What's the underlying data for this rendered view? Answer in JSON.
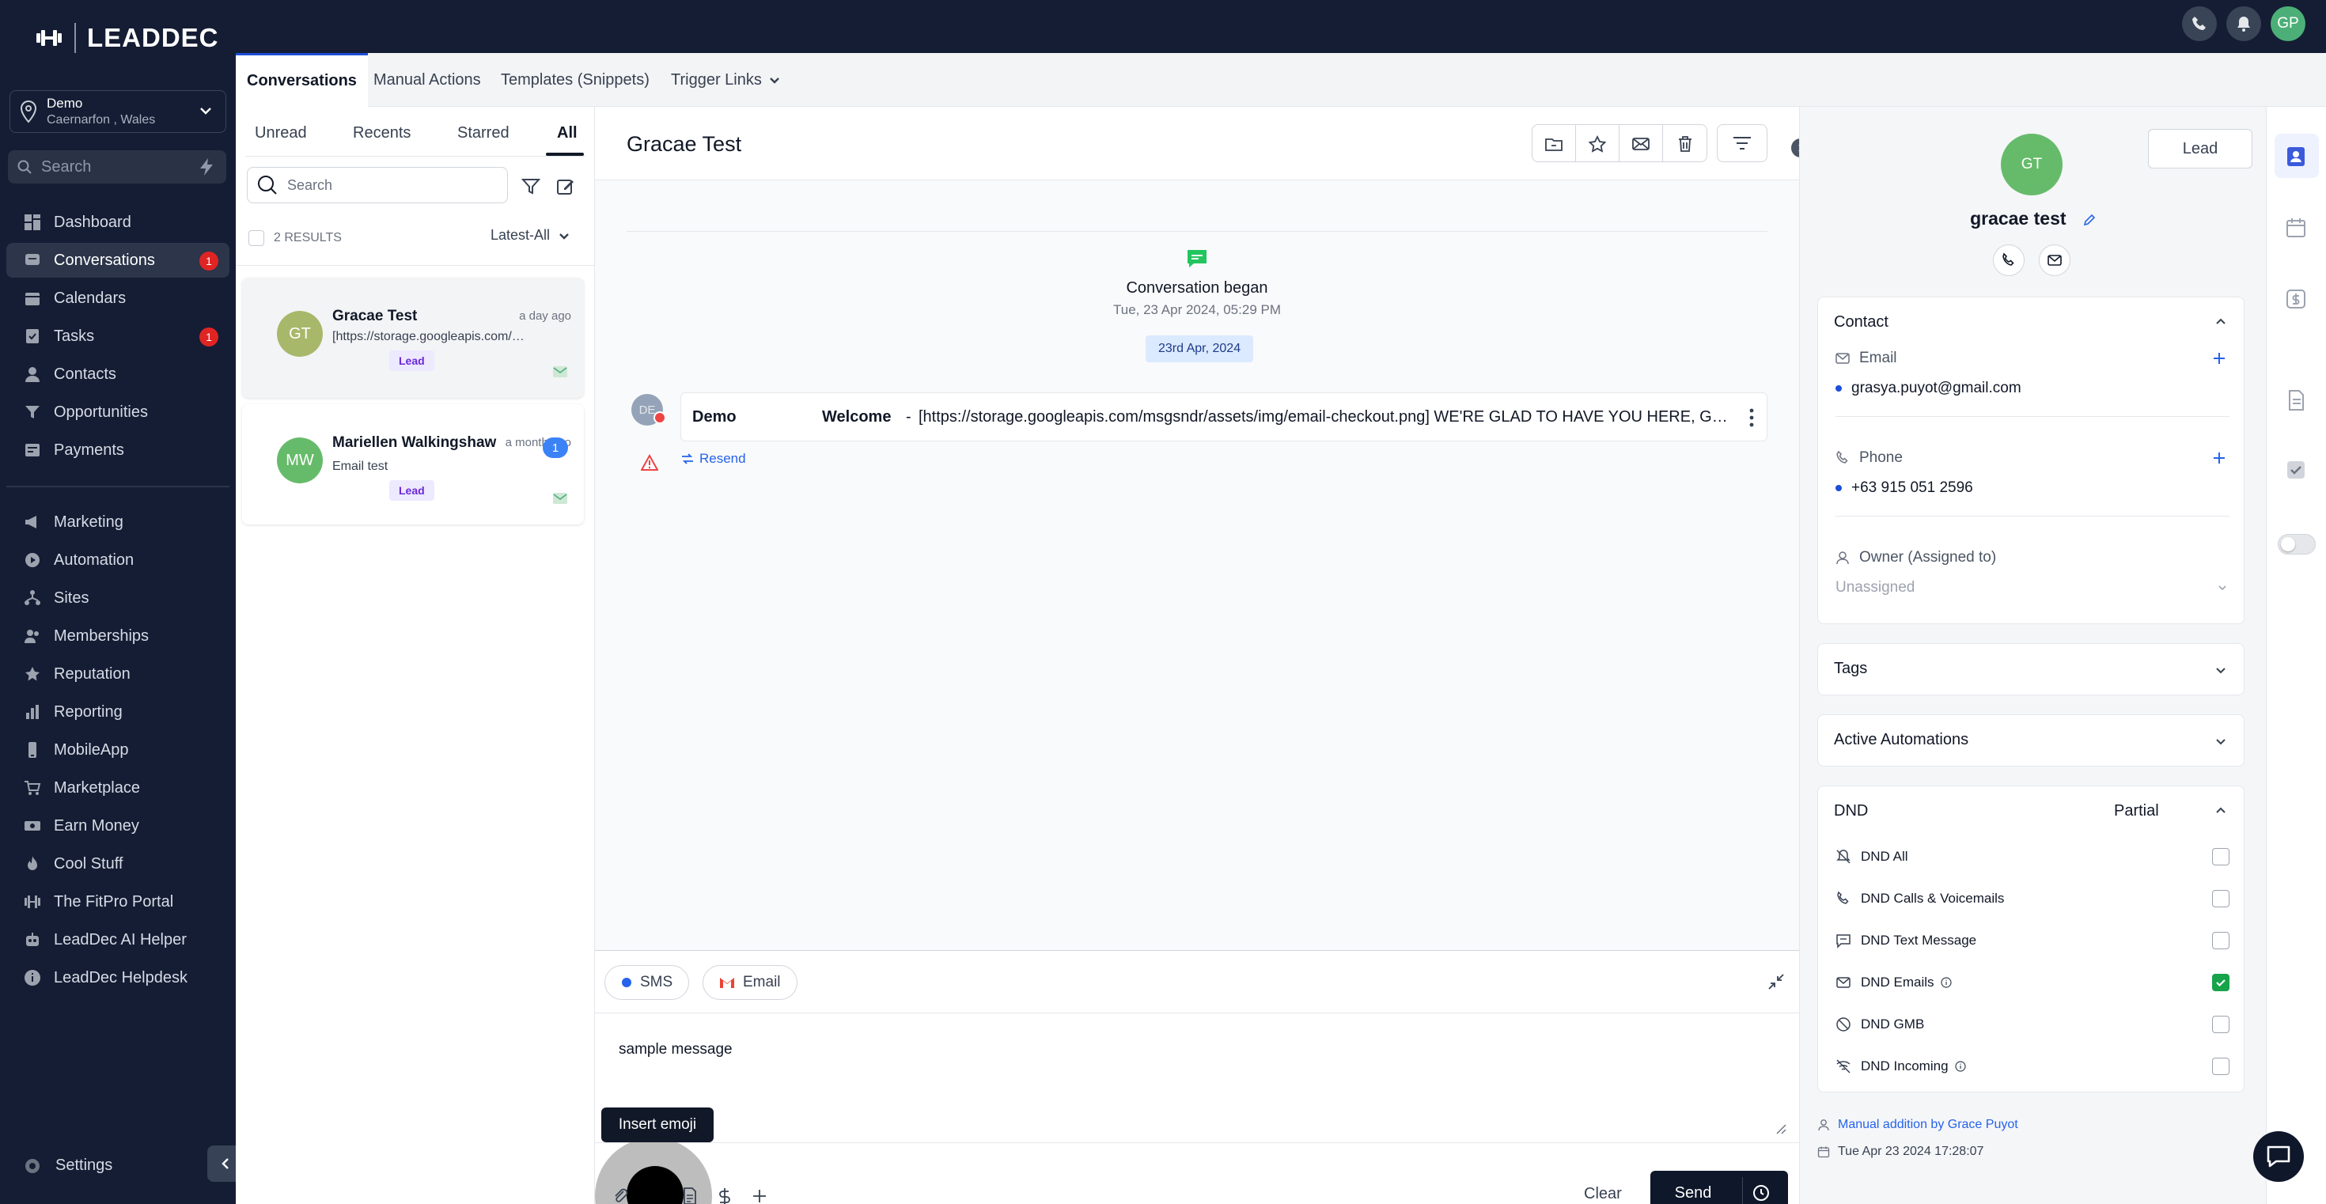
{
  "brand": {
    "name": "LEADDEC"
  },
  "location": {
    "name": "Demo",
    "sub": "Caernarfon , Wales"
  },
  "sidebar": {
    "search_placeholder": "Search",
    "items": [
      {
        "label": "Dashboard"
      },
      {
        "label": "Conversations",
        "badge": "1"
      },
      {
        "label": "Calendars"
      },
      {
        "label": "Tasks",
        "badge": "1"
      },
      {
        "label": "Contacts"
      },
      {
        "label": "Opportunities"
      },
      {
        "label": "Payments"
      }
    ],
    "items2": [
      {
        "label": "Marketing"
      },
      {
        "label": "Automation"
      },
      {
        "label": "Sites"
      },
      {
        "label": "Memberships"
      },
      {
        "label": "Reputation"
      },
      {
        "label": "Reporting"
      },
      {
        "label": "MobileApp"
      },
      {
        "label": "Marketplace"
      },
      {
        "label": "Earn Money"
      },
      {
        "label": "Cool Stuff"
      },
      {
        "label": "The FitPro Portal"
      },
      {
        "label": "LeadDec AI Helper"
      },
      {
        "label": "LeadDec Helpdesk"
      }
    ],
    "settings": "Settings"
  },
  "topbar": {
    "avatar": "GP"
  },
  "subnav": {
    "tabs": [
      "Conversations",
      "Manual Actions",
      "Templates (Snippets)",
      "Trigger Links"
    ]
  },
  "list": {
    "tabs": [
      "Unread",
      "Recents",
      "Starred",
      "All"
    ],
    "search_placeholder": "Search",
    "results": "2 RESULTS",
    "sort": "Latest-All",
    "items": [
      {
        "initials": "GT",
        "name": "Gracae Test",
        "time": "a day ago",
        "preview": "[https://storage.googleapis.com/msgsndr/assets/img/email-checkout.png]",
        "tag": "Lead",
        "color": "#a7b86a"
      },
      {
        "initials": "MW",
        "name": "Mariellen Walkingshaw",
        "time": "a month ago",
        "preview": "Email test",
        "tag": "Lead",
        "unread": "1",
        "color": "#66bb6a"
      }
    ]
  },
  "conversation": {
    "title": "Gracae Test",
    "began": "Conversation began",
    "began_date": "Tue, 23 Apr 2024, 05:29 PM",
    "date_pill": "23rd Apr, 2024",
    "message": {
      "avatar": "DE",
      "from": "Demo",
      "subject": "Welcome",
      "dash": "-",
      "body": "[https://storage.googleapis.com/msgsndr/assets/img/email-checkout.png] WE'RE GLAD TO HAVE YOU HERE, GRACAE TEST"
    },
    "resend": "Resend"
  },
  "composer": {
    "sms": "SMS",
    "email": "Email",
    "text": "sample message",
    "tooltip": "Insert emoji",
    "clear": "Clear",
    "send": "Send"
  },
  "contact": {
    "lead_button": "Lead",
    "initials": "GT",
    "name": "gracae test",
    "contact_header": "Contact",
    "email_label": "Email",
    "email": "grasya.puyot@gmail.com",
    "phone_label": "Phone",
    "phone": "+63 915 051 2596",
    "owner_label": "Owner (Assigned to)",
    "owner": "Unassigned",
    "tags": "Tags",
    "automations": "Active Automations",
    "dnd": "DND",
    "dnd_status": "Partial",
    "dnd_items": [
      {
        "label": "DND All",
        "checked": false
      },
      {
        "label": "DND Calls & Voicemails",
        "checked": false
      },
      {
        "label": "DND Text Message",
        "checked": false
      },
      {
        "label": "DND Emails",
        "checked": true
      },
      {
        "label": "DND GMB",
        "checked": false
      },
      {
        "label": "DND Incoming",
        "checked": false
      }
    ],
    "source": "Manual addition by Grace Puyot",
    "created": "Tue Apr 23 2024 17:28:07"
  },
  "colors": {
    "sidebar": "#141d33",
    "accent": "#1d4ed8",
    "send": "#0f172a",
    "avatar_green": "#66bb6a",
    "dnd_checked": "#16a34a"
  }
}
